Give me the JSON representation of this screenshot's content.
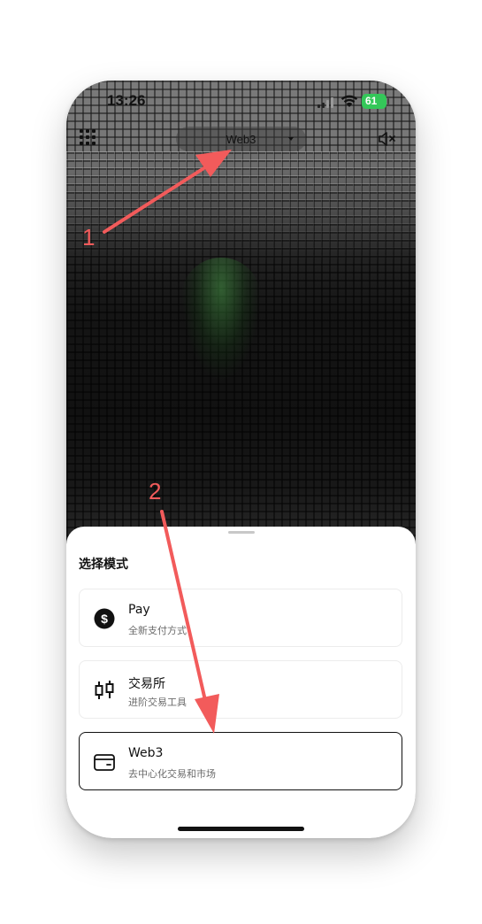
{
  "status_bar": {
    "time": "13:26",
    "battery": "61"
  },
  "top_bar": {
    "mode_label": "Web3"
  },
  "sheet": {
    "title": "选择模式",
    "options": [
      {
        "icon": "dollar-circle-icon",
        "title": "Pay",
        "subtitle": "全新支付方式"
      },
      {
        "icon": "candlestick-icon",
        "title": "交易所",
        "subtitle": "进阶交易工具"
      },
      {
        "icon": "wallet-icon",
        "title": "Web3",
        "subtitle": "去中心化交易和市场",
        "selected": true
      }
    ]
  },
  "annotations": {
    "step1": "1",
    "step2": "2",
    "color": "#f25b5b"
  },
  "colors": {
    "battery": "#34c759",
    "selected_border": "#111111"
  }
}
